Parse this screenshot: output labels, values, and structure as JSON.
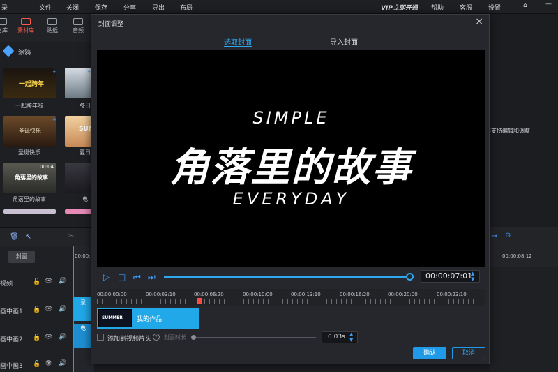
{
  "menu": {
    "left_partial": "录",
    "items": [
      "文件",
      "关闭",
      "保存",
      "分享",
      "导出",
      "布局"
    ],
    "vip": "VIP立即开通",
    "right_items": [
      "帮助",
      "客服",
      "设置"
    ]
  },
  "toolbar": {
    "tabs": [
      {
        "label": "材库",
        "icon": "media-icon"
      },
      {
        "label": "素材库",
        "icon": "library-icon"
      },
      {
        "label": "贴纸",
        "icon": "sticker-icon"
      },
      {
        "label": "音频",
        "icon": "audio-icon"
      }
    ]
  },
  "left_panel": {
    "category": "涂鸦",
    "thumbs": [
      {
        "label": "一起跨年啦",
        "overlay": "一起跨年"
      },
      {
        "label": "冬日"
      },
      {
        "label": "圣诞快乐",
        "overlay": "圣诞快乐"
      },
      {
        "label": "夏日",
        "overlay": "SUM"
      },
      {
        "label": "角落里的故事",
        "overlay": "角落里的故事",
        "duration": "00:04"
      },
      {
        "label": "电"
      }
    ]
  },
  "timeline": {
    "cover_button": "封面",
    "start_time": "00:00:0",
    "tracks": [
      "视频",
      "画中画1",
      "画中画2",
      "画中画3"
    ],
    "clip_labels": [
      "录",
      "电"
    ],
    "right_time": "00:00:08:12"
  },
  "right_panel": {
    "note": "不支持编辑和调整"
  },
  "dialog": {
    "title": "封面调整",
    "tabs": [
      "选取封面",
      "导入封面"
    ],
    "preview": {
      "line1": "SIMPLE",
      "line2": "角落里的故事",
      "line3": "EVERYDAY"
    },
    "current_time": "00:00:07:01",
    "playback_progress": 0.99,
    "ruler_labels": [
      "00:00:00:00",
      "00:00:03:10",
      "00:00:06:20",
      "00:00:10:00",
      "00:00:13:10",
      "00:00:16:20",
      "00:00:20:00",
      "00:00:23:10"
    ],
    "clip": {
      "thumb_text": "SUMMER",
      "label": "我的作品"
    },
    "add_to_start": "添加到视频片头",
    "duration_label": "封面时长",
    "duration_value": "0.03s",
    "ok": "确认",
    "cancel": "取消"
  }
}
